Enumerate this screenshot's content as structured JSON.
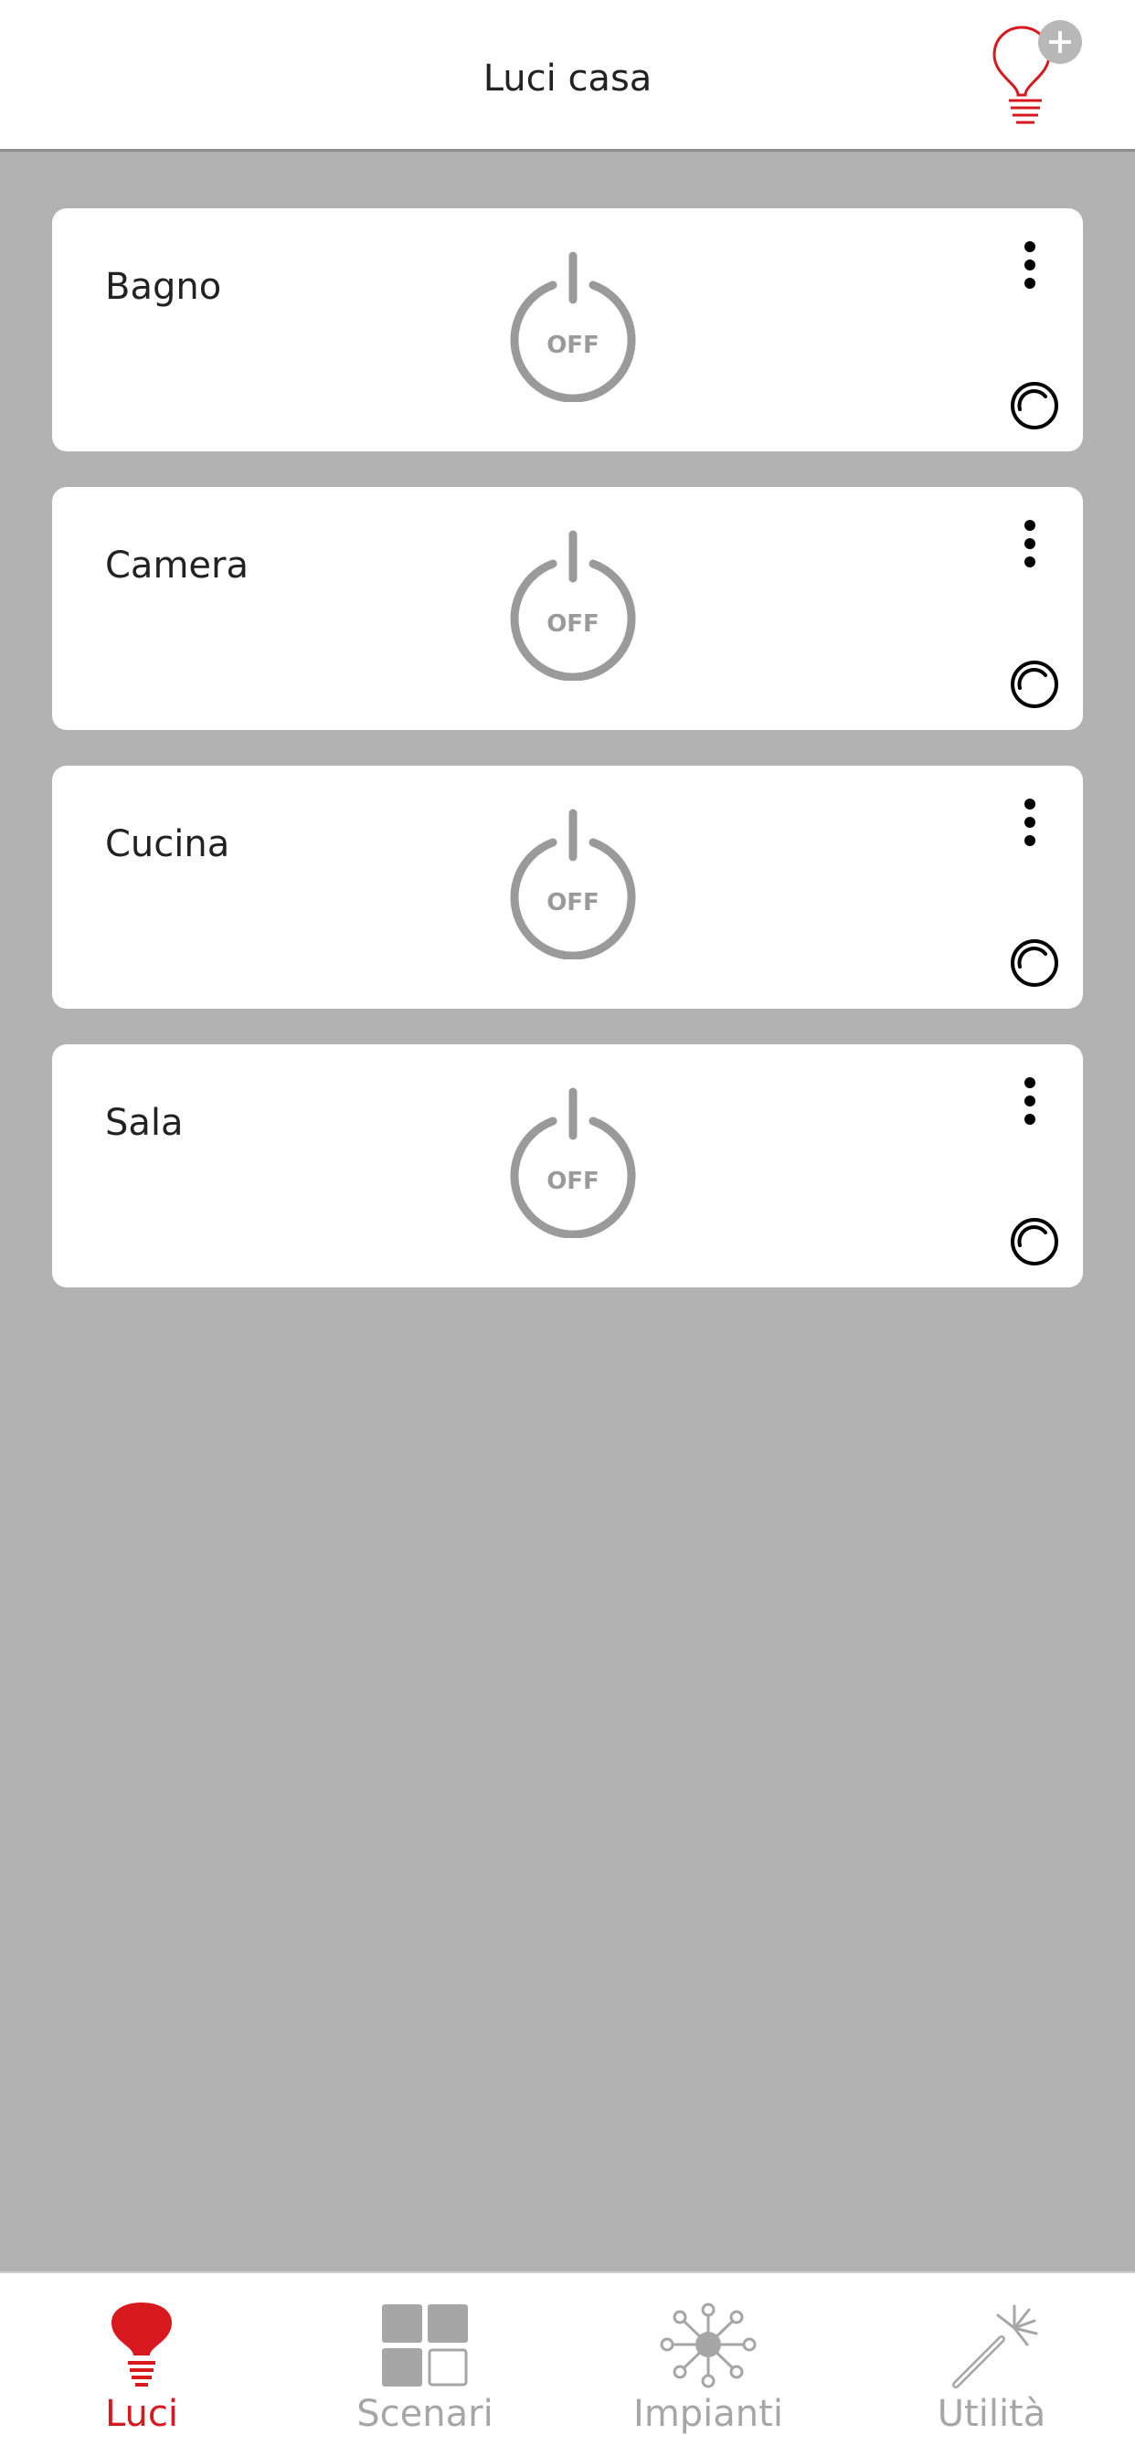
{
  "header": {
    "title": "Luci casa",
    "add_icon": "add-light-bulb-icon"
  },
  "colors": {
    "accent": "#d7191f",
    "background": "#b2b2b2",
    "card": "#ffffff",
    "inactive": "#a6a6a6",
    "power_off": "#9a9a9a"
  },
  "rooms": [
    {
      "name": "Bagno",
      "state": "OFF"
    },
    {
      "name": "Camera",
      "state": "OFF"
    },
    {
      "name": "Cucina",
      "state": "OFF"
    },
    {
      "name": "Sala",
      "state": "OFF"
    }
  ],
  "tabs": [
    {
      "label": "Luci",
      "icon": "light-bulb-icon",
      "active": true
    },
    {
      "label": "Scenari",
      "icon": "scenes-grid-icon",
      "active": false
    },
    {
      "label": "Impianti",
      "icon": "network-hub-icon",
      "active": false
    },
    {
      "label": "Utilità",
      "icon": "magic-wand-icon",
      "active": false
    }
  ]
}
